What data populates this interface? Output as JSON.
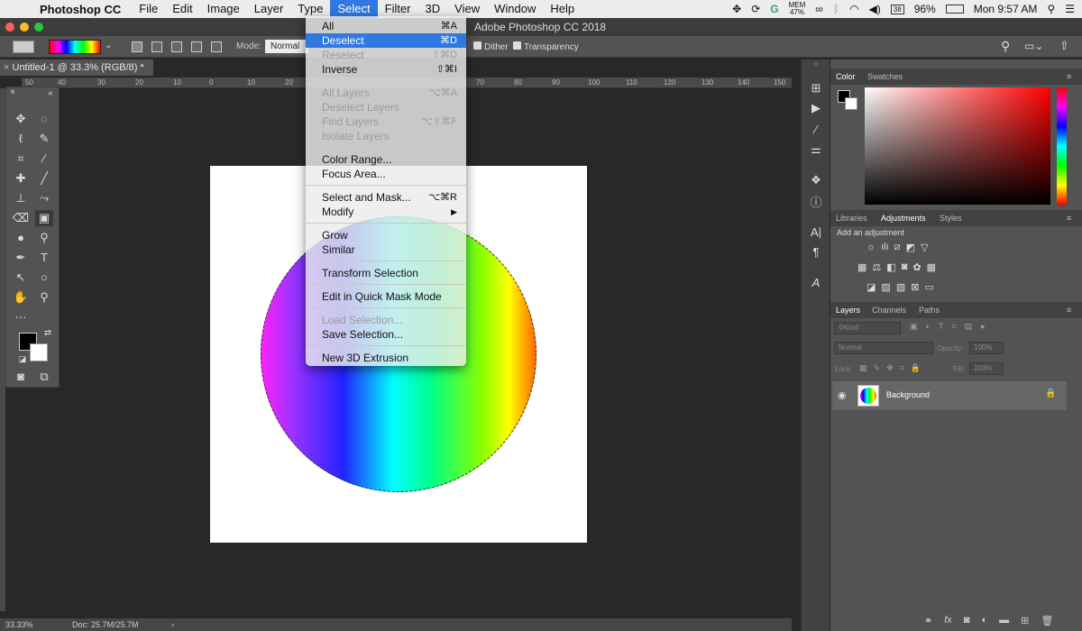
{
  "menubar": {
    "app_name": "Photoshop CC",
    "menus": [
      "File",
      "Edit",
      "Image",
      "Layer",
      "Type",
      "Select",
      "Filter",
      "3D",
      "View",
      "Window",
      "Help"
    ],
    "active_menu": "Select",
    "mem_label": "MEM",
    "mem_value": "47%",
    "battery": "96%",
    "clock": "Mon 9:57 AM"
  },
  "window": {
    "title": "Adobe Photoshop CC 2018"
  },
  "options": {
    "mode_label": "Mode:",
    "mode_value": "Normal",
    "dither": "Dither",
    "transparency": "Transparency"
  },
  "document": {
    "tab_title": "Untitled-1 @ 33.3% (RGB/8) *",
    "ruler_ticks": [
      "50",
      "40",
      "30",
      "20",
      "10",
      "0",
      "10",
      "20",
      "70",
      "80",
      "90",
      "100",
      "110",
      "120",
      "130",
      "140",
      "150"
    ]
  },
  "status": {
    "zoom": "33.33%",
    "doc": "Doc: 25.7M/25.7M"
  },
  "select_menu": {
    "items": [
      {
        "label": "All",
        "shortcut": "⌘A",
        "state": "normal"
      },
      {
        "label": "Deselect",
        "shortcut": "⌘D",
        "state": "highlighted"
      },
      {
        "label": "Reselect",
        "shortcut": "⇧⌘D",
        "state": "disabled"
      },
      {
        "label": "Inverse",
        "shortcut": "⇧⌘I",
        "state": "normal"
      },
      {
        "label": "All Layers",
        "shortcut": "⌥⌘A",
        "state": "disabled"
      },
      {
        "label": "Deselect Layers",
        "shortcut": "",
        "state": "disabled"
      },
      {
        "label": "Find Layers",
        "shortcut": "⌥⇧⌘F",
        "state": "disabled"
      },
      {
        "label": "Isolate Layers",
        "shortcut": "",
        "state": "disabled"
      },
      {
        "label": "Color Range...",
        "shortcut": "",
        "state": "normal"
      },
      {
        "label": "Focus Area...",
        "shortcut": "",
        "state": "normal"
      },
      {
        "label": "Select and Mask...",
        "shortcut": "⌥⌘R",
        "state": "normal"
      },
      {
        "label": "Modify",
        "shortcut": "▶",
        "state": "normal"
      },
      {
        "label": "Grow",
        "shortcut": "",
        "state": "normal"
      },
      {
        "label": "Similar",
        "shortcut": "",
        "state": "normal"
      },
      {
        "label": "Transform Selection",
        "shortcut": "",
        "state": "normal"
      },
      {
        "label": "Edit in Quick Mask Mode",
        "shortcut": "",
        "state": "normal"
      },
      {
        "label": "Load Selection...",
        "shortcut": "",
        "state": "disabled"
      },
      {
        "label": "Save Selection...",
        "shortcut": "",
        "state": "normal"
      },
      {
        "label": "New 3D Extrusion",
        "shortcut": "",
        "state": "normal"
      }
    ]
  },
  "color_panel": {
    "tabs": [
      "Color",
      "Swatches"
    ]
  },
  "adjustments_panel": {
    "tabs": [
      "Libraries",
      "Adjustments",
      "Styles"
    ],
    "heading": "Add an adjustment"
  },
  "layers_panel": {
    "tabs": [
      "Layers",
      "Channels",
      "Paths"
    ],
    "kind_placeholder": "Kind",
    "blend_mode": "Normal",
    "opacity_label": "Opacity:",
    "opacity_value": "100%",
    "lock_label": "Lock:",
    "fill_label": "Fill:",
    "fill_value": "100%",
    "layers": [
      {
        "name": "Background",
        "visible": true,
        "locked": true
      }
    ]
  }
}
